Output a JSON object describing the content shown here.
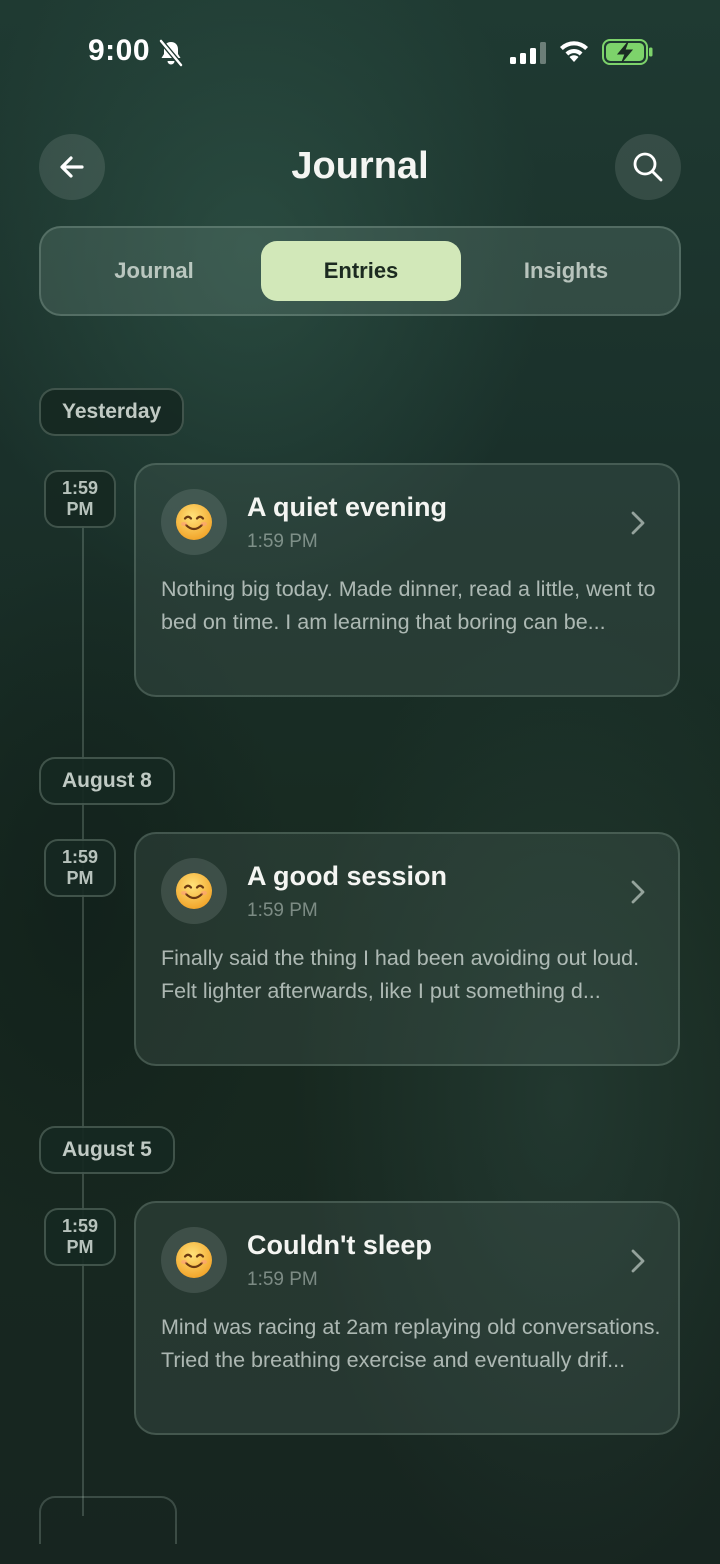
{
  "status_bar": {
    "time": "9:00"
  },
  "header": {
    "title": "Journal"
  },
  "tabs": [
    {
      "label": "Journal"
    },
    {
      "label": "Entries"
    },
    {
      "label": "Insights"
    }
  ],
  "selected_tab": "Entries",
  "groups": [
    {
      "date": "Yesterday",
      "entries": [
        {
          "time_chip": [
            "1:59",
            "PM"
          ],
          "mood": "😊",
          "title": "A quiet evening",
          "time": "1:59 PM",
          "preview": "Nothing big today. Made dinner, read a little, went to bed on time. I am learning that boring can be..."
        }
      ]
    },
    {
      "date": "August 8",
      "entries": [
        {
          "time_chip": [
            "1:59",
            "PM"
          ],
          "mood": "😊",
          "title": "A good session",
          "time": "1:59 PM",
          "preview": "Finally said the thing I had been avoiding out loud. Felt lighter afterwards, like I put something d..."
        }
      ]
    },
    {
      "date": "August 5",
      "entries": [
        {
          "time_chip": [
            "1:59",
            "PM"
          ],
          "mood": "😊",
          "title": "Couldn't sleep",
          "time": "1:59 PM",
          "preview": "Mind was racing at 2am replaying old conversations. Tried the breathing exercise and eventually drif..."
        }
      ]
    }
  ],
  "colors": {
    "background": "#1a302a",
    "segment_active": "#d2e8b9",
    "battery": "#7dd36b"
  }
}
